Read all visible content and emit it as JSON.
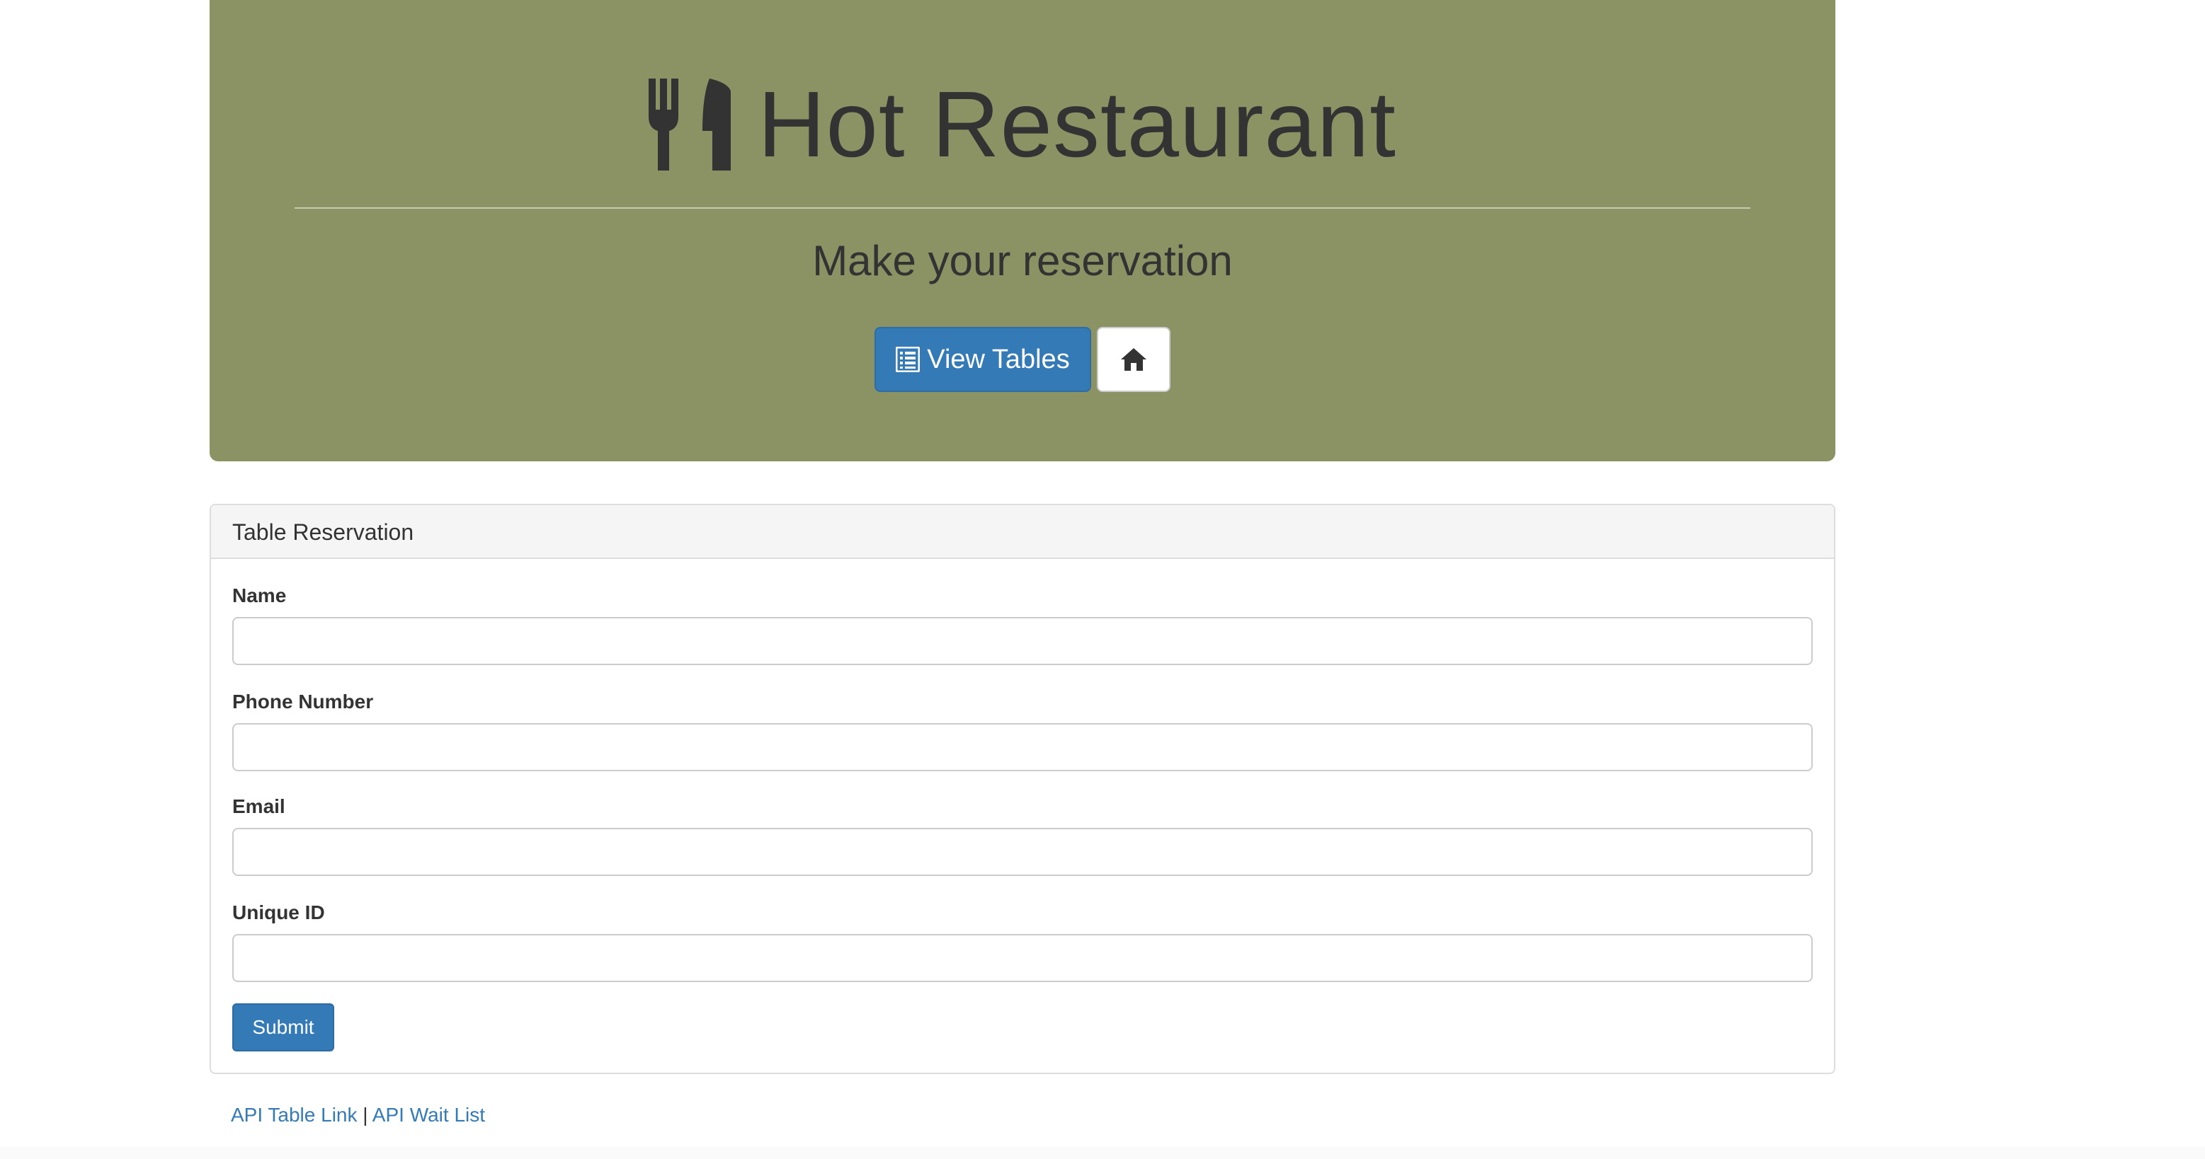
{
  "header": {
    "title": "Hot Restaurant",
    "subtitle": "Make your reservation",
    "brand_icon": "cutlery-icon",
    "view_tables_label": "View Tables",
    "view_tables_icon": "list-alt-icon",
    "home_icon": "home-icon"
  },
  "panel": {
    "heading": "Table Reservation",
    "fields": [
      {
        "label": "Name",
        "value": "",
        "placeholder": ""
      },
      {
        "label": "Phone Number",
        "value": "",
        "placeholder": ""
      },
      {
        "label": "Email",
        "value": "",
        "placeholder": ""
      },
      {
        "label": "Unique ID",
        "value": "",
        "placeholder": ""
      }
    ],
    "submit_label": "Submit"
  },
  "footer": {
    "links": [
      {
        "label": "API Table Link"
      },
      {
        "label": "API Wait List"
      }
    ],
    "separator": "|"
  },
  "colors": {
    "jumbotron_bg": "#8b9263",
    "primary": "#337ab7",
    "text": "#333333"
  }
}
